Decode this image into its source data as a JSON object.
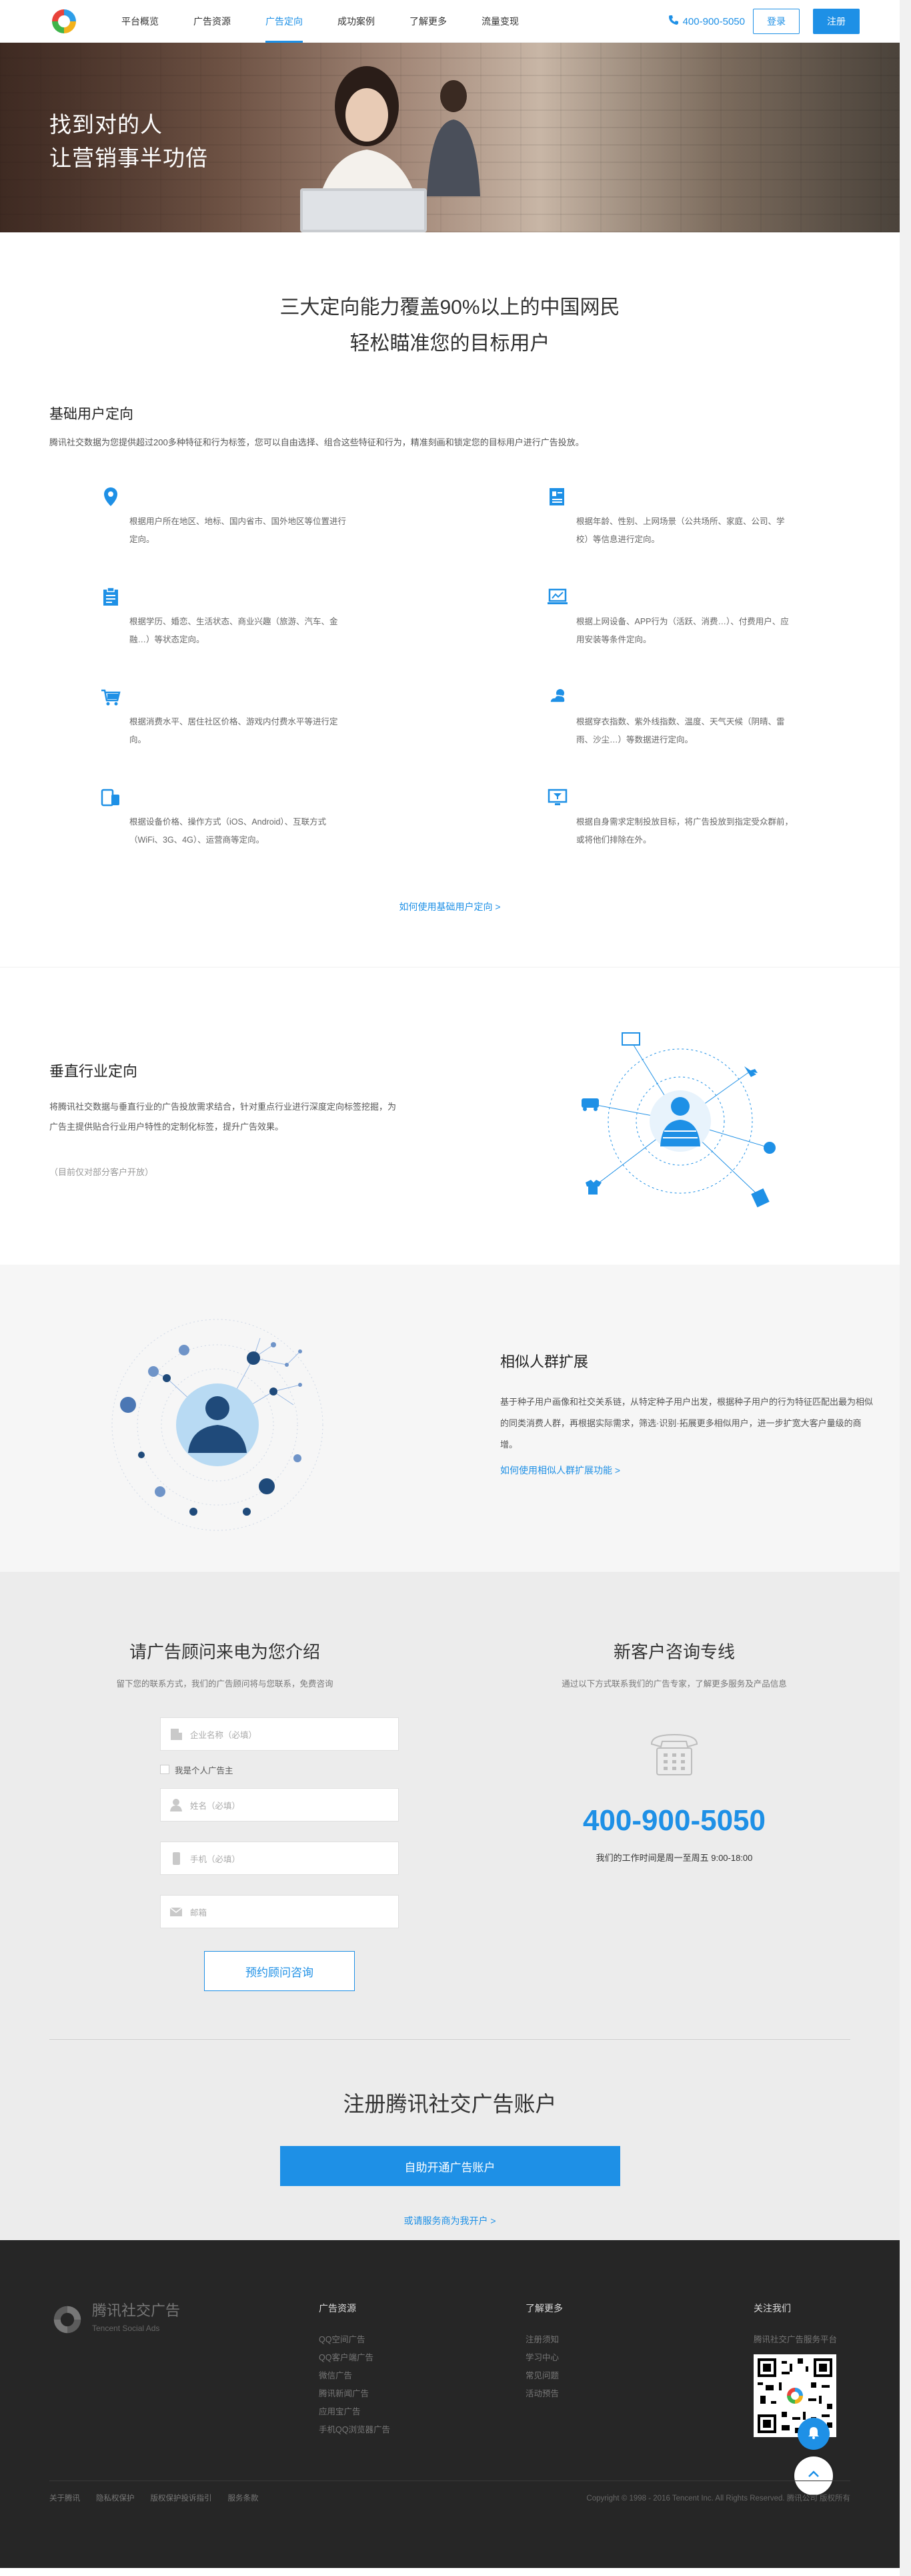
{
  "header": {
    "nav": [
      "平台概览",
      "广告资源",
      "广告定向",
      "成功案例",
      "了解更多",
      "流量变现"
    ],
    "active_index": 2,
    "phone": "400-900-5050",
    "login": "登录",
    "register": "注册"
  },
  "hero": {
    "line1": "找到对的人",
    "line2": "让营销事半功倍"
  },
  "basic": {
    "headline1": "三大定向能力覆盖90%以上的中国网民",
    "headline2": "轻松瞄准您的目标用户",
    "title": "基础用户定向",
    "desc": "腾讯社交数据为您提供超过200多种特征和行为标签，您可以自由选择、组合这些特征和行为，精准刻画和锁定您的目标用户进行广告投放。",
    "items": [
      {
        "icon": "location-pin-icon",
        "text": "根据用户所在地区、地标、国内省市、国外地区等位置进行定向。"
      },
      {
        "icon": "id-card-icon",
        "text": "根据年龄、性别、上网场景（公共场所、家庭、公司、学校）等信息进行定向。"
      },
      {
        "icon": "clipboard-icon",
        "text": "根据学历、婚恋、生活状态、商业兴趣（旅游、汽车、金融…）等状态定向。"
      },
      {
        "icon": "laptop-chart-icon",
        "text": "根据上网设备、APP行为（活跃、消费…）、付费用户、应用安装等条件定向。"
      },
      {
        "icon": "shopping-cart-icon",
        "text": "根据消费水平、居住社区价格、游戏内付费水平等进行定向。"
      },
      {
        "icon": "weather-icon",
        "text": "根据穿衣指数、紫外线指数、温度、天气天候（阴晴、雷雨、沙尘…）等数据进行定向。"
      },
      {
        "icon": "devices-icon",
        "text": "根据设备价格、操作方式（iOS、Android）、互联方式（WiFi、3G、4G）、运营商等定向。"
      },
      {
        "icon": "monitor-filter-icon",
        "text": "根据自身需求定制投放目标，将广告投放到指定受众群前，或将他们排除在外。"
      }
    ],
    "link": "如何使用基础用户定向 >"
  },
  "vertical": {
    "title": "垂直行业定向",
    "desc": "将腾讯社交数据与垂直行业的广告投放需求结合，针对重点行业进行深度定向标签挖掘，为广告主提供贴合行业用户特性的定制化标签，提升广告效果。",
    "note": "（目前仅对部分客户开放）"
  },
  "similar": {
    "title": "相似人群扩展",
    "desc": "基于种子用户画像和社交关系链，从特定种子用户出发，根据种子用户的行为特征匹配出最为相似的同类消费人群，再根据实际需求，筛选·识别·拓展更多相似用户，进一步扩宽大客户量级的商增。",
    "link": "如何使用相似人群扩展功能 >"
  },
  "contact": {
    "left_title": "请广告顾问来电为您介绍",
    "left_sub": "留下您的联系方式，我们的广告顾问将与您联系，免费咨询",
    "company_placeholder": "企业名称（必填）",
    "personal_label": "我是个人广告主",
    "name_placeholder": "姓名（必填）",
    "mobile_placeholder": "手机（必填）",
    "email_placeholder": "邮箱",
    "consult_button": "预约顾问咨询",
    "right_title": "新客户咨询专线",
    "right_sub": "通过以下方式联系我们的广告专家，了解更多服务及产品信息",
    "hotline": "400-900-5050",
    "hours": "我们的工作时间是周一至周五 9:00-18:00"
  },
  "register": {
    "title": "注册腾讯社交广告账户",
    "button": "自助开通广告账户",
    "link": "或请服务商为我开户 >"
  },
  "footer": {
    "brand": "腾讯社交广告",
    "brand_en": "Tencent Social Ads",
    "cols": [
      {
        "title": "广告资源",
        "links": [
          "QQ空间广告",
          "QQ客户端广告",
          "微信广告",
          "腾讯新闻广告",
          "应用宝广告",
          "手机QQ浏览器广告"
        ]
      },
      {
        "title": "了解更多",
        "links": [
          "注册须知",
          "学习中心",
          "常见问题",
          "活动预告"
        ]
      },
      {
        "title": "关注我们",
        "links": [
          "腾讯社交广告服务平台"
        ]
      }
    ],
    "bottom_links": [
      "关于腾讯",
      "隐私权保护",
      "版权保护投诉指引",
      "服务条款"
    ],
    "copyright": "Copyright © 1998 - 2016   Tencent Inc. All Rights Reserved. 腾讯公司 版权所有"
  },
  "colors": {
    "accent": "#1e90e6",
    "footer_bg": "#262626",
    "contact_bg": "#ececec"
  }
}
